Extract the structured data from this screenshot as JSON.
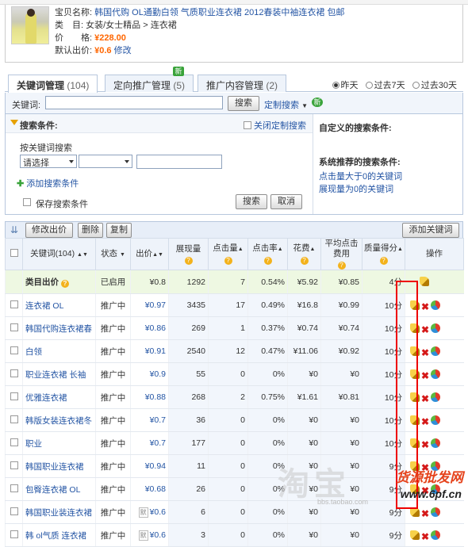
{
  "product": {
    "name_label": "宝贝名称:",
    "name": "韩国代购 OL通勤白领 气质职业连衣裙 2012春装中袖连衣裙 包邮",
    "category_label": "类　目:",
    "category": "女装/女士精品 > 连衣裙",
    "price_label": "价　　格:",
    "price": "¥228.00",
    "default_bid_label": "默认出价:",
    "default_bid": "¥0.6",
    "modify": "修改"
  },
  "tabs": [
    {
      "label": "关键词管理",
      "count": "(104)",
      "active": true
    },
    {
      "label": "定向推广管理",
      "count": "(5)",
      "badge": "新"
    },
    {
      "label": "推广内容管理",
      "count": "(2)"
    }
  ],
  "date_filters": [
    "昨天",
    "过去7天",
    "过去30天"
  ],
  "date_selected": "昨天",
  "keyword_search": {
    "label": "关键词:",
    "value": "",
    "search_button": "搜索",
    "custom_search": "定制搜索",
    "new_badge": "新"
  },
  "conditions": {
    "title": "搜索条件:",
    "close_custom": "关闭定制搜索",
    "by_keyword": "按关键词搜索",
    "select_value": "请选择",
    "add_condition": "添加搜索条件",
    "save_condition": "保存搜索条件",
    "search_button": "搜索",
    "cancel_button": "取消",
    "custom_title": "自定义的搜索条件:",
    "recommend_title": "系统推荐的搜索条件:",
    "recommend_links": [
      "点击量大于0的关键词",
      "展现量为0的关键词"
    ]
  },
  "toolbar": {
    "modify_bid": "修改出价",
    "delete": "删除",
    "copy": "复制",
    "add_keyword": "添加关键词"
  },
  "table": {
    "headers": [
      "关键词(104)",
      "状态",
      "出价",
      "展现量",
      "点击量",
      "点击率",
      "花费",
      "平均点击费用",
      "质量得分",
      "操作"
    ],
    "category_row": {
      "keyword": "类目出价",
      "status": "已启用",
      "bid": "¥0.8",
      "impressions": "1292",
      "clicks": "7",
      "ctr": "0.54%",
      "cost": "¥5.92",
      "avg_cpc": "¥0.85",
      "quality": "4分"
    },
    "rows": [
      {
        "keyword": "连衣裙 OL",
        "status": "推广中",
        "bid": "¥0.97",
        "impressions": "3435",
        "clicks": "17",
        "ctr": "0.49%",
        "cost": "¥16.8",
        "avg_cpc": "¥0.99",
        "quality": "10分"
      },
      {
        "keyword": "韩国代购连衣裙春",
        "status": "推广中",
        "bid": "¥0.86",
        "impressions": "269",
        "clicks": "1",
        "ctr": "0.37%",
        "cost": "¥0.74",
        "avg_cpc": "¥0.74",
        "quality": "10分"
      },
      {
        "keyword": "白领",
        "status": "推广中",
        "bid": "¥0.91",
        "impressions": "2540",
        "clicks": "12",
        "ctr": "0.47%",
        "cost": "¥11.06",
        "avg_cpc": "¥0.92",
        "quality": "10分"
      },
      {
        "keyword": "职业连衣裙 长袖",
        "status": "推广中",
        "bid": "¥0.9",
        "impressions": "55",
        "clicks": "0",
        "ctr": "0%",
        "cost": "¥0",
        "avg_cpc": "¥0",
        "quality": "10分"
      },
      {
        "keyword": "优雅连衣裙",
        "status": "推广中",
        "bid": "¥0.88",
        "impressions": "268",
        "clicks": "2",
        "ctr": "0.75%",
        "cost": "¥1.61",
        "avg_cpc": "¥0.81",
        "quality": "10分"
      },
      {
        "keyword": "韩版女装连衣裙冬",
        "status": "推广中",
        "bid": "¥0.7",
        "impressions": "36",
        "clicks": "0",
        "ctr": "0%",
        "cost": "¥0",
        "avg_cpc": "¥0",
        "quality": "10分"
      },
      {
        "keyword": "职业",
        "status": "推广中",
        "bid": "¥0.7",
        "impressions": "177",
        "clicks": "0",
        "ctr": "0%",
        "cost": "¥0",
        "avg_cpc": "¥0",
        "quality": "10分"
      },
      {
        "keyword": "韩国职业连衣裙",
        "status": "推广中",
        "bid": "¥0.94",
        "impressions": "11",
        "clicks": "0",
        "ctr": "0%",
        "cost": "¥0",
        "avg_cpc": "¥0",
        "quality": "9分"
      },
      {
        "keyword": "包臀连衣裙 OL",
        "status": "推广中",
        "bid": "¥0.68",
        "impressions": "26",
        "clicks": "0",
        "ctr": "0%",
        "cost": "¥0",
        "avg_cpc": "¥0",
        "quality": "9分"
      },
      {
        "keyword": "韩国职业装连衣裙",
        "status": "推广中",
        "bid": "¥0.6",
        "bid_tag": "默",
        "impressions": "6",
        "clicks": "0",
        "ctr": "0%",
        "cost": "¥0",
        "avg_cpc": "¥0",
        "quality": "9分"
      },
      {
        "keyword": "韩 ol气质 连衣裙",
        "status": "推广中",
        "bid": "¥0.6",
        "bid_tag": "默",
        "impressions": "3",
        "clicks": "0",
        "ctr": "0%",
        "cost": "¥0",
        "avg_cpc": "¥0",
        "quality": "9分"
      }
    ]
  },
  "watermarks": {
    "taobao": "淘宝",
    "site_cn": "货源批发网",
    "site_en": "www.6pf.cn",
    "bbs": "bbs.taobao.com"
  },
  "colors": {
    "link": "#2455a4",
    "price": "#ff6600",
    "highlight_border": "#ee0000",
    "category_row": "#eef8e2"
  }
}
